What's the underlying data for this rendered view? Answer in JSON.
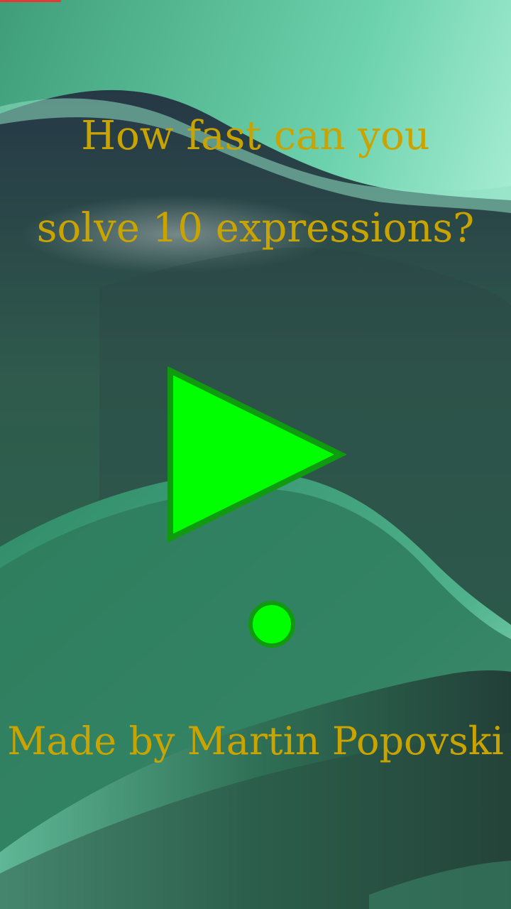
{
  "title": {
    "line1": "How fast can you",
    "line2": "solve 10 expressions?"
  },
  "credit": "Made by Martin Popovski",
  "play_button": {
    "icon": "play-triangle-icon"
  },
  "secondary_button": {
    "icon": "circle-icon"
  },
  "colors": {
    "text": "#c9a400",
    "button_fill": "#00ff00",
    "button_stroke": "#0f9a0f",
    "background_dark": "#273a40",
    "background_mid": "#2f8a63",
    "background_light": "#b5f7e2",
    "top_indicator": "#e53935"
  }
}
